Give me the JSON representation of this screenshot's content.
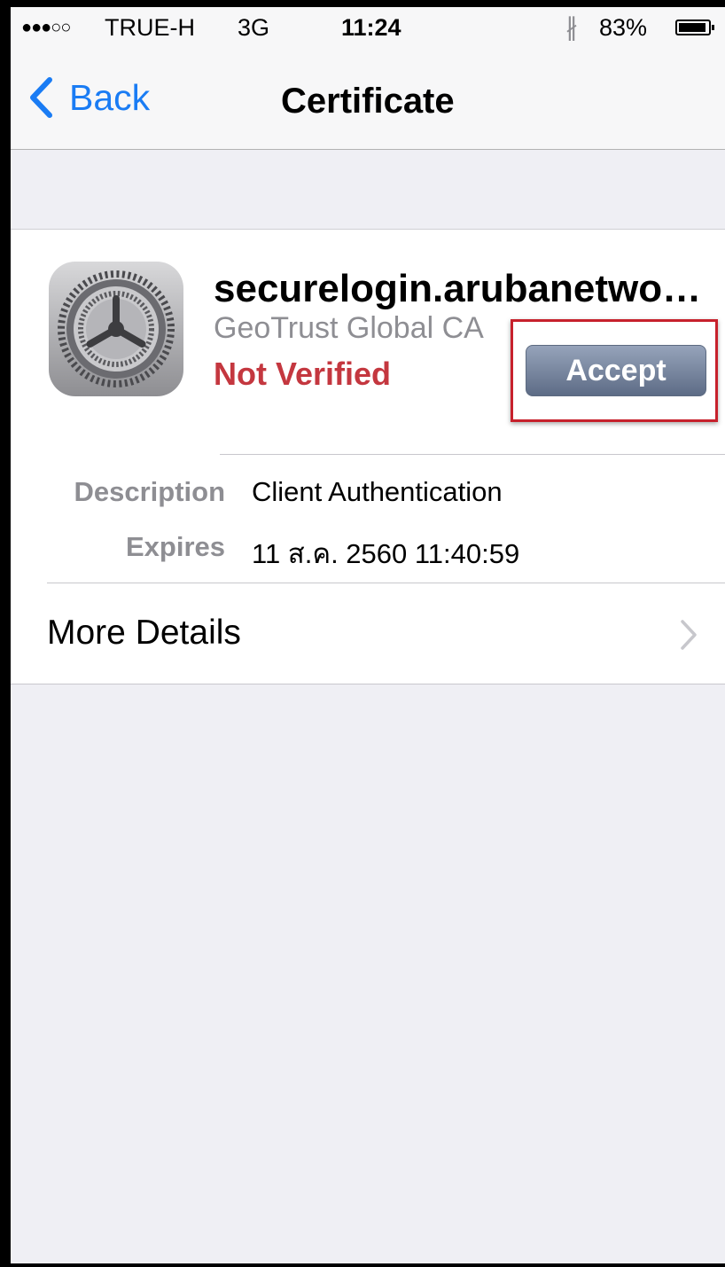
{
  "status_bar": {
    "signal": "●●●○○",
    "carrier": "TRUE-H",
    "network": "3G",
    "time": "11:24",
    "bluetooth_glyph": "∦",
    "battery_percent": "83%",
    "icons": [
      "bluetooth-icon",
      "battery-icon"
    ]
  },
  "nav": {
    "back_label": "Back",
    "title": "Certificate",
    "icons": [
      "chevron-left-icon"
    ]
  },
  "certificate": {
    "name": "securelogin.arubanetwo…",
    "issuer": "GeoTrust Global CA",
    "status": "Not Verified",
    "accept_label": "Accept",
    "icon": "settings-gear-icon",
    "details": [
      {
        "label": "Description",
        "value": "Client Authentication"
      },
      {
        "label": "Expires",
        "value": "11 ส.ค. 2560 11:40:59"
      }
    ],
    "more_details_label": "More Details"
  },
  "colors": {
    "tint": "#1a7cf4",
    "warning": "#c4373f",
    "background": "#efeff4",
    "highlight": "#c7212c",
    "accept_button": "#6f7d96"
  }
}
